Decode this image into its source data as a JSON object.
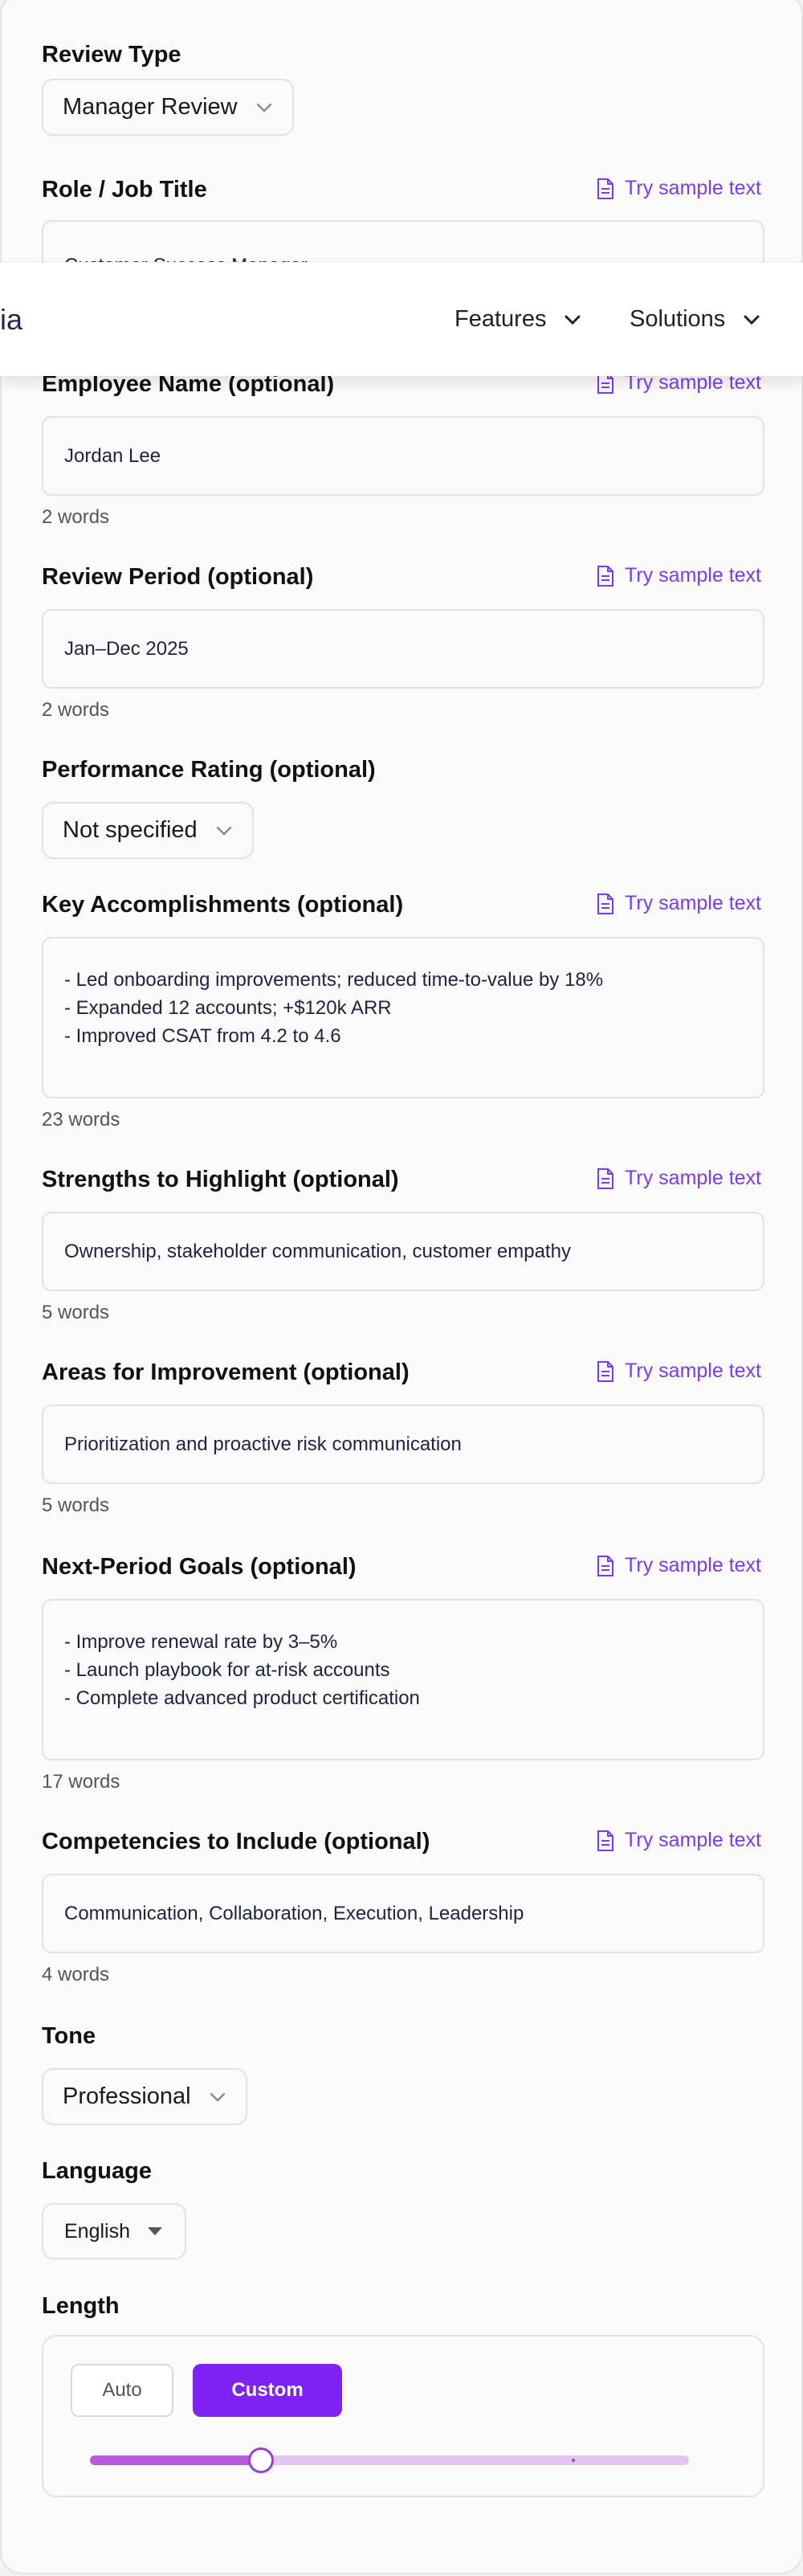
{
  "sample_link_label": "Try sample text",
  "review_type": {
    "label": "Review Type",
    "value": "Manager Review"
  },
  "role": {
    "label": "Role / Job Title",
    "value": "Customer Success Manager"
  },
  "navbar": {
    "logo_fragment": "ia",
    "items": [
      {
        "label": "Features"
      },
      {
        "label": "Solutions"
      }
    ]
  },
  "employee": {
    "label": "Employee Name (optional)",
    "value": "Jordan Lee",
    "word_count": "2 words"
  },
  "period": {
    "label": "Review Period (optional)",
    "value": "Jan–Dec 2025",
    "word_count": "2 words"
  },
  "rating": {
    "label": "Performance Rating (optional)",
    "value": "Not specified"
  },
  "accomplishments": {
    "label": "Key Accomplishments (optional)",
    "value": "- Led onboarding improvements; reduced time-to-value by 18%\n- Expanded 12 accounts; +$120k ARR\n- Improved CSAT from 4.2 to 4.6",
    "word_count": "23 words"
  },
  "strengths": {
    "label": "Strengths to Highlight (optional)",
    "value": "Ownership, stakeholder communication, customer empathy",
    "word_count": "5 words"
  },
  "improvement": {
    "label": "Areas for Improvement (optional)",
    "value": "Prioritization and proactive risk communication",
    "word_count": "5 words"
  },
  "goals": {
    "label": "Next-Period Goals (optional)",
    "value": "- Improve renewal rate by 3–5%\n- Launch playbook for at-risk accounts\n- Complete advanced product certification",
    "word_count": "17 words"
  },
  "competencies": {
    "label": "Competencies to Include (optional)",
    "value": "Communication, Collaboration, Execution, Leadership",
    "word_count": "4 words"
  },
  "tone": {
    "label": "Tone",
    "value": "Professional"
  },
  "language": {
    "label": "Language",
    "value": "English"
  },
  "length": {
    "label": "Length",
    "auto_label": "Auto",
    "custom_label": "Custom",
    "selected": "Custom",
    "slider_fraction": 0.285
  },
  "colors": {
    "accent": "#7e22f5",
    "link": "#7c3aed",
    "slider_fill": "#b65cdc",
    "slider_track": "#e2c6f0"
  }
}
